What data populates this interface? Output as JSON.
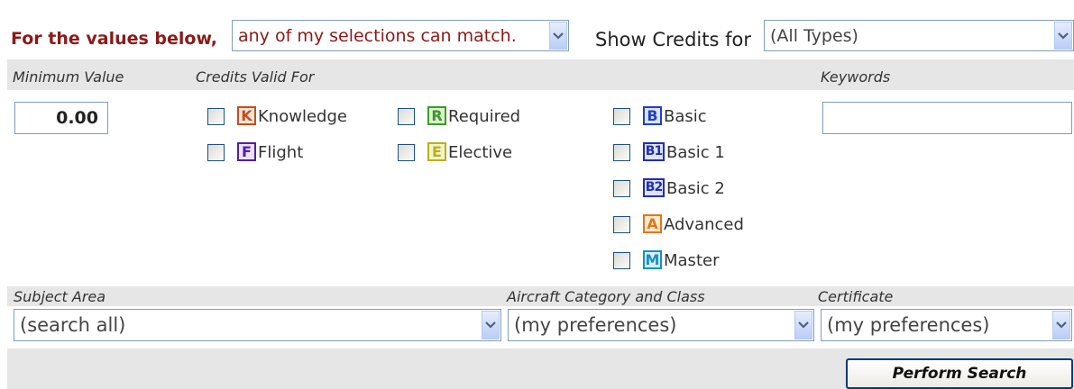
{
  "header": {
    "values_label": "For the values below,",
    "match_select": "any of my selections can match.",
    "show_credits_label": "Show Credits for",
    "credits_select": "(All Types)"
  },
  "columns": {
    "minimum_value": "Minimum Value",
    "credits_valid_for": "Credits Valid For",
    "keywords": "Keywords"
  },
  "minimum_value": "0.00",
  "keywords_value": "",
  "credit_options": [
    {
      "badge": "K",
      "label": "Knowledge",
      "color": "#c0501e",
      "bg": "#fbe6d8",
      "checked": false
    },
    {
      "badge": "F",
      "label": "Flight",
      "color": "#5020a0",
      "bg": "#ece3fa",
      "checked": false
    },
    {
      "badge": "R",
      "label": "Required",
      "color": "#3a9a2a",
      "bg": "#dff3cf",
      "checked": false
    },
    {
      "badge": "E",
      "label": "Elective",
      "color": "#b8b020",
      "bg": "#f6f3c8",
      "checked": false
    },
    {
      "badge": "B",
      "label": "Basic",
      "color": "#2040c0",
      "bg": "#dbe4fb",
      "checked": false
    },
    {
      "badge": "B1",
      "label": "Basic 1",
      "color": "#2030b0",
      "bg": "#dfe3fb",
      "checked": false
    },
    {
      "badge": "B2",
      "label": "Basic 2",
      "color": "#2030b0",
      "bg": "#dfe3fb",
      "checked": false
    },
    {
      "badge": "A",
      "label": "Advanced",
      "color": "#e07818",
      "bg": "#fde9d4",
      "checked": false
    },
    {
      "badge": "M",
      "label": "Master",
      "color": "#1890c0",
      "bg": "#d6effa",
      "checked": false
    }
  ],
  "bottom": {
    "subject_area_label": "Subject Area",
    "subject_area_value": "(search all)",
    "aircraft_label": "Aircraft Category and Class",
    "aircraft_value": "(my preferences)",
    "certificate_label": "Certificate",
    "certificate_value": "(my preferences)"
  },
  "perform_search": "Perform Search",
  "colors": {
    "accent_red": "#8b1a1a",
    "header_gray": "#e6e6e6",
    "border_blue": "#7f9db9"
  }
}
